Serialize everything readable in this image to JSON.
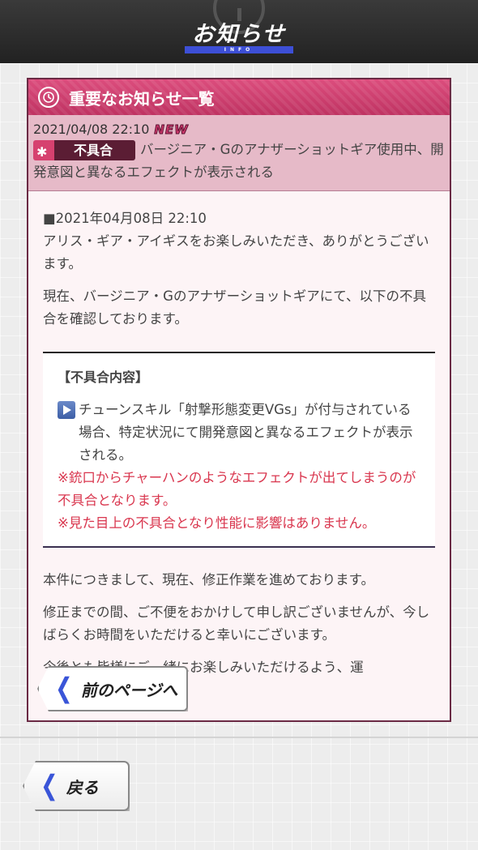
{
  "header": {
    "title": "お知らせ",
    "subtitle": "INFO"
  },
  "panel": {
    "title": "重要なお知らせ一覧",
    "icon": "clock-icon"
  },
  "article": {
    "date": "2021/04/08 22:10",
    "new_badge": "NEW",
    "tag_label": "不具合",
    "tag_icon": "bug-icon",
    "title": "バージニア・Gのアナザーショットギア使用中、開発意図と異なるエフェクトが表示される"
  },
  "body": {
    "date_line": "■2021年04月08日 22:10",
    "para1": "アリス・ギア・アイギスをお楽しみいただき、ありがとうございます。",
    "para2": "現在、バージニア・Gのアナザーショットギアにて、以下の不具合を確認しております。",
    "box": {
      "heading": "【不具合内容】",
      "item": "チューンスキル「射撃形態変更VGs」が付与されている場合、特定状況にて開発意図と異なるエフェクトが表示される。",
      "note1": "※銃口からチャーハンのようなエフェクトが出てしまうのが不具合となります。",
      "note2": "※見た目上の不具合となり性能に影響はありません。"
    },
    "para3": "本件につきまして、現在、修正作業を進めております。",
    "para4": "修正までの間、ご不便をおかけして申し訳ございませんが、今しばらくお時間をいただけると幸いにございます。",
    "para5": "今後とも皆様にご一緒にお楽しみいただけるよう、運"
  },
  "buttons": {
    "prev_page": "前のページへ",
    "back": "戻る"
  },
  "colors": {
    "accent": "#3a55d8",
    "panel_header": "#c8396a",
    "note_red": "#d9364e"
  }
}
